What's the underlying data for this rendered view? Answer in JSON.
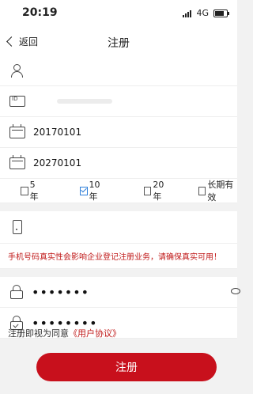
{
  "status": {
    "time": "20:19",
    "network": "4G"
  },
  "nav": {
    "back_label": "返回",
    "title": "注册"
  },
  "form": {
    "dates": {
      "start": "20170101",
      "end": "20270101"
    },
    "validity_options": [
      "5年",
      "10年",
      "20年",
      "长期有效"
    ],
    "selected_validity": "10年",
    "phone_warning": "手机号码真实性会影响企业登记注册业务，请确保真实可用！",
    "password_mask": "•••••••",
    "confirm_mask": "••••••••"
  },
  "agreement": {
    "prefix": "注册即视为同意",
    "link": "《用户协议》"
  },
  "submit_label": "注册",
  "colors": {
    "accent": "#c8101c",
    "check": "#2f7fd9"
  }
}
